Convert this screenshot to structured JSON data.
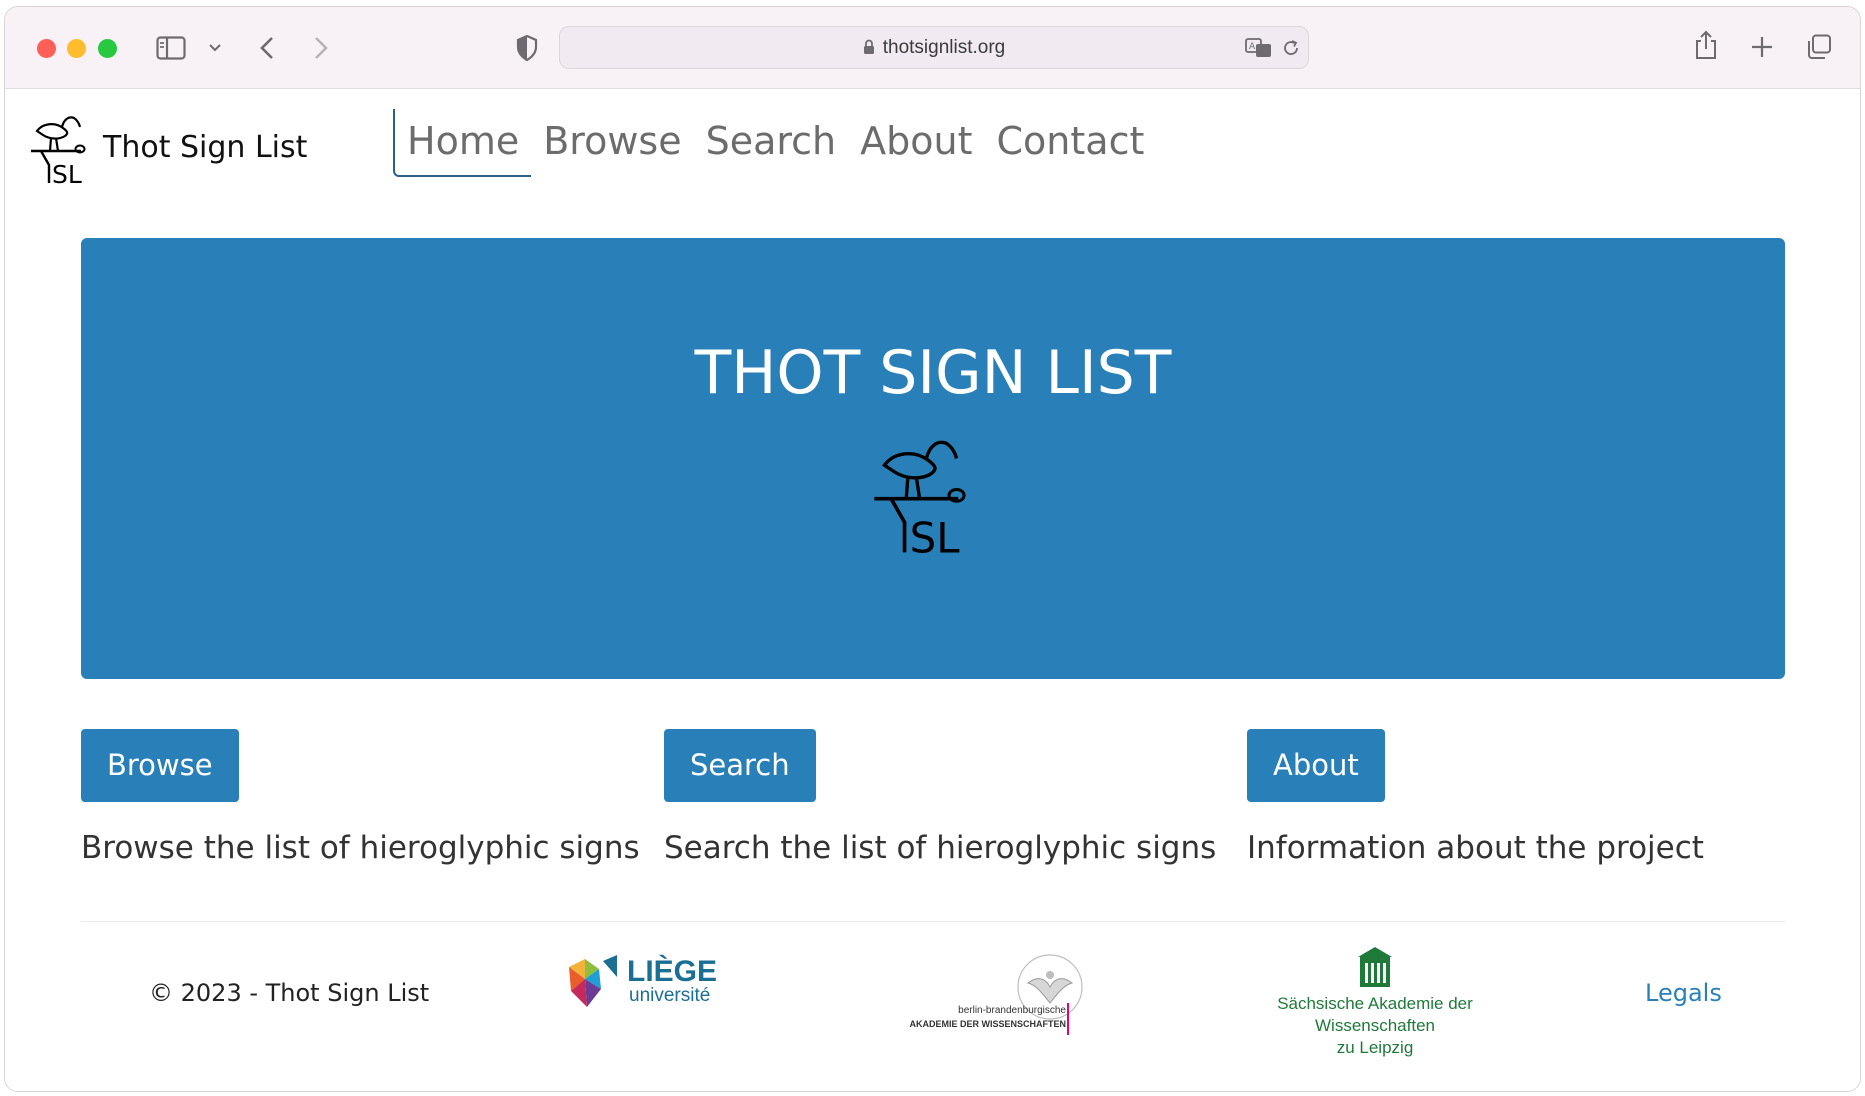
{
  "browser": {
    "url": "thotsignlist.org"
  },
  "site": {
    "brand": "Thot Sign List",
    "nav": [
      "Home",
      "Browse",
      "Search",
      "About",
      "Contact"
    ],
    "active_nav": "Home"
  },
  "hero": {
    "title": "THOT SIGN LIST"
  },
  "cards": [
    {
      "button": "Browse",
      "description": "Browse the list of hieroglyphic signs"
    },
    {
      "button": "Search",
      "description": "Search the list of hieroglyphic signs"
    },
    {
      "button": "About",
      "description": "Information about the project"
    }
  ],
  "footer": {
    "copyright": "© 2023 - Thot Sign List",
    "liege_logo": {
      "line1": "LIÈGE",
      "line2": "université"
    },
    "bbaw_logo": {
      "line1": "berlin-brandenburgische",
      "line2": "AKADEMIE DER WISSENSCHAFTEN"
    },
    "saw_logo": {
      "line1": "Sächsische Akademie der Wissenschaften",
      "line2": "zu Leipzig"
    },
    "legals": "Legals"
  },
  "colors": {
    "primary": "#2980b9",
    "hero_bg": "#2980b9"
  }
}
